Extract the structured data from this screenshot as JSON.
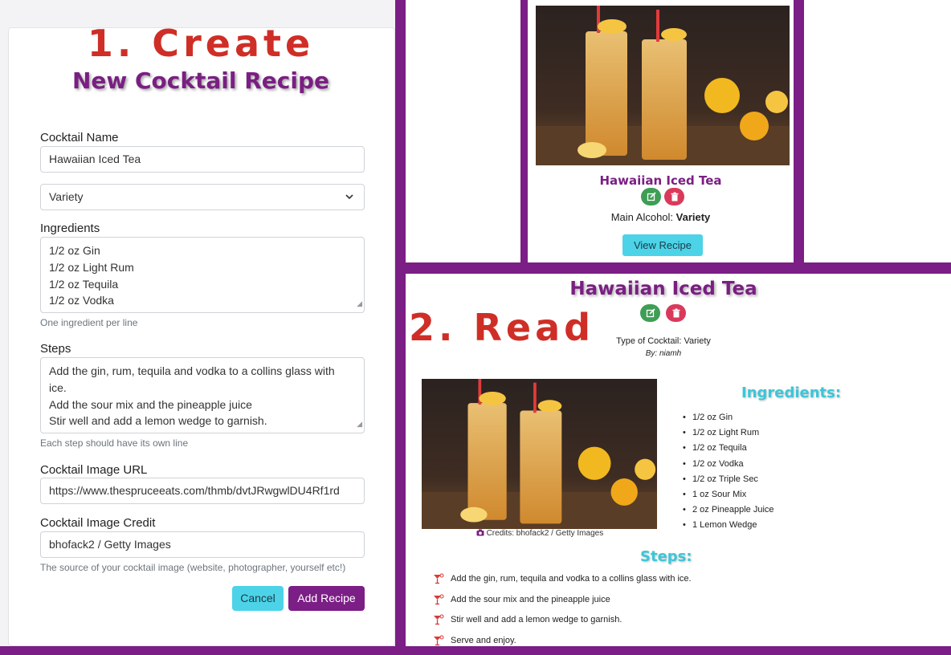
{
  "create_panel": {
    "heading": "1. Create",
    "subheading": "New Cocktail Recipe",
    "name_label": "Cocktail Name",
    "name_value": "Hawaiian Iced Tea",
    "variety_value": "Variety",
    "ingredients_label": "Ingredients",
    "ingredients_lines": [
      "1/2 oz Gin",
      "1/2 oz Light Rum",
      "1/2 oz Tequila",
      "1/2 oz Vodka"
    ],
    "ingredients_help": "One ingredient per line",
    "steps_label": "Steps",
    "steps_lines": [
      "Add the gin, rum, tequila and vodka to a collins glass with",
      "ice.",
      "Add the sour mix and the pineapple juice",
      "Stir well and add a lemon wedge to garnish."
    ],
    "steps_help": "Each step should have its own line",
    "image_url_label": "Cocktail Image URL",
    "image_url_value": "https://www.thespruceeats.com/thmb/dvtJRwgwlDU4Rf1rd",
    "image_credit_label": "Cocktail Image Credit",
    "image_credit_value": "bhofack2 / Getty Images",
    "image_credit_help": "The source of your cocktail image (website, photographer, yourself etc!)",
    "cancel_label": "Cancel",
    "add_label": "Add Recipe"
  },
  "card_panel": {
    "title": "Hawaiian Iced Tea",
    "alcohol_prefix": "Main Alcohol: ",
    "alcohol_value": "Variety",
    "view_label": "View Recipe"
  },
  "read_panel": {
    "heading": "2. Read",
    "title": "Hawaiian Iced Tea",
    "type_line": "Type of Cocktail: Variety",
    "by_line": "By: niamh",
    "credits": "Credits: bhofack2 / Getty Images",
    "ingredients_heading": "Ingredients:",
    "ingredients": [
      "1/2 oz Gin",
      "1/2 oz Light Rum",
      "1/2 oz Tequila",
      "1/2 oz Vodka",
      "1/2 oz Triple Sec",
      "1 oz Sour Mix",
      "2 oz Pineapple Juice",
      "1 Lemon Wedge"
    ],
    "steps_heading": "Steps:",
    "steps": [
      "Add the gin, rum, tequila and vodka to a collins glass with ice.",
      "Add the sour mix and the pineapple juice",
      "Stir well and add a lemon wedge to garnish.",
      "Serve and enjoy."
    ]
  },
  "colors": {
    "brand_purple": "#7b1e85",
    "heading_red": "#cf2e26",
    "accent_cyan": "#4cd3e8",
    "edit_green": "#3f9e55",
    "delete_red": "#d93a5b"
  },
  "icons": {
    "edit": "edit-icon",
    "delete": "trash-icon",
    "camera": "camera-icon",
    "cocktail": "cocktail-glass-icon"
  }
}
